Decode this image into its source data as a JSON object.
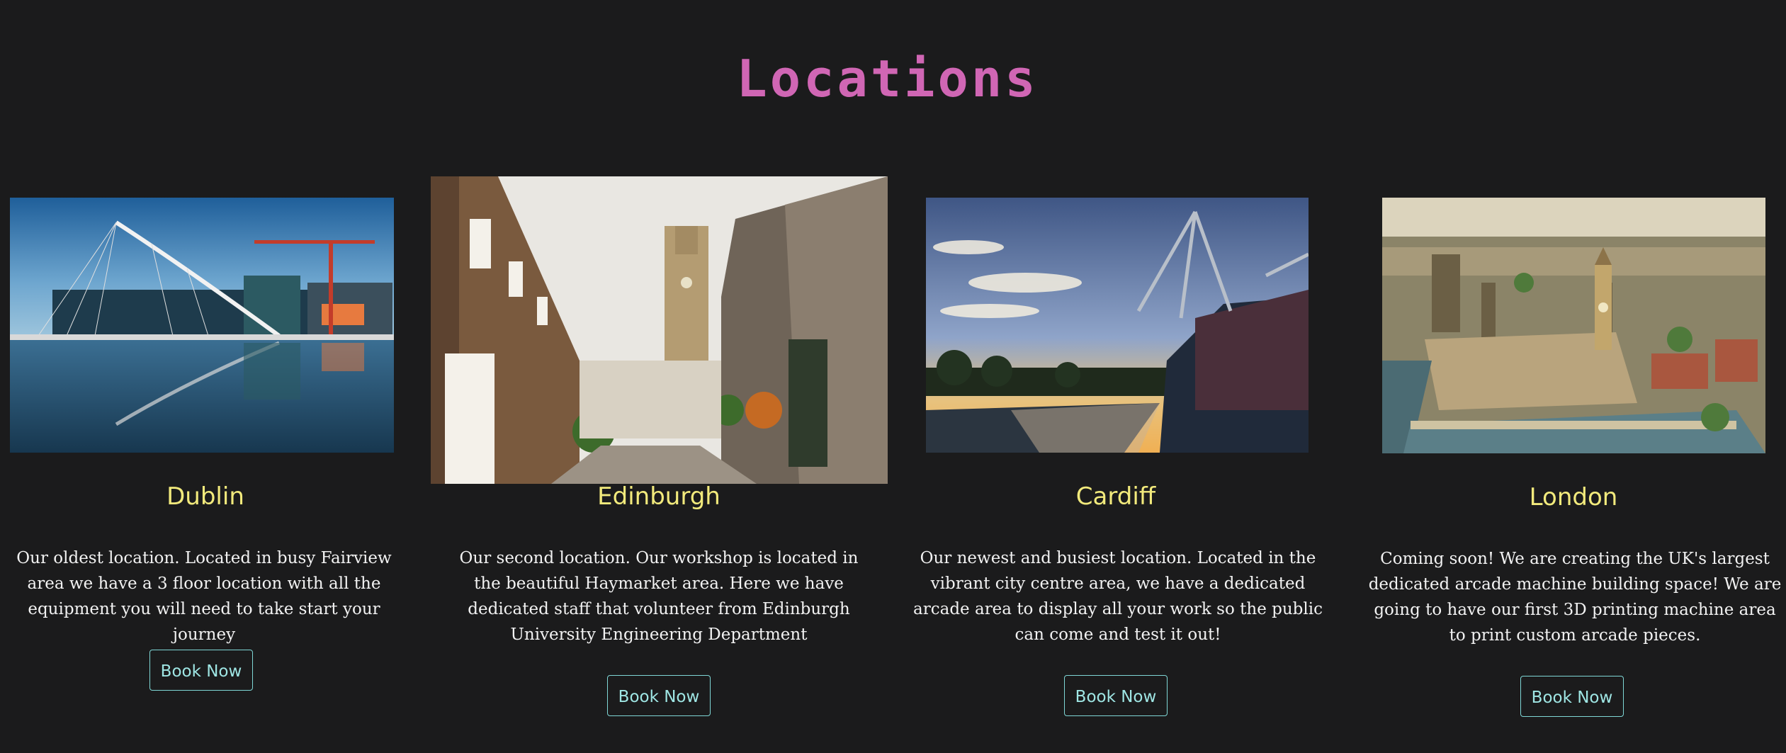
{
  "section": {
    "title": "Locations"
  },
  "locations": [
    {
      "name": "Dublin",
      "description": "Our oldest location. Located in busy Fairview area we have a 3 floor location with all the equipment you will need to take start your journey",
      "button_label": "Book Now"
    },
    {
      "name": "Edinburgh",
      "description": "Our second location. Our workshop is located in the beautiful Haymarket area. Here we have dedicated staff that volunteer from Edinburgh University Engineering Department",
      "button_label": "Book Now"
    },
    {
      "name": "Cardiff",
      "description": "Our newest and busiest location. Located in the vibrant city centre area, we have a dedicated arcade area to display all your work so the public can come and test it out!",
      "button_label": "Book Now"
    },
    {
      "name": "London",
      "description": "Coming soon! We are creating the UK's largest dedicated arcade machine building space! We are going to have our first 3D printing machine area to print custom arcade pieces.",
      "button_label": "Book Now"
    }
  ],
  "colors": {
    "background": "#1b1b1c",
    "title": "#d066b4",
    "card_title": "#f2ea7c",
    "button_border": "#7fd7d6"
  }
}
